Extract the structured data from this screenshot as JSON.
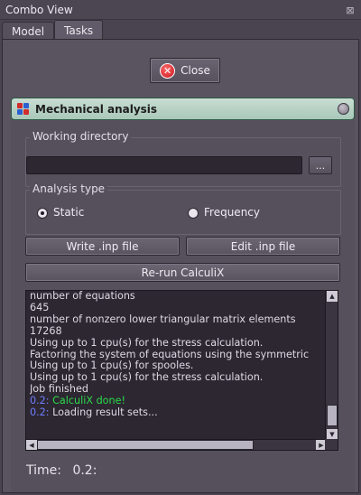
{
  "window": {
    "title": "Combo View",
    "ctrl_icon": "float-close-icon"
  },
  "tabs": [
    {
      "label": "Model"
    },
    {
      "label": "Tasks",
      "active": true
    }
  ],
  "close_button": {
    "label": "Close",
    "icon": "close-icon"
  },
  "mechanical_analysis": {
    "title": "Mechanical analysis",
    "working_directory": {
      "label": "Working directory",
      "value": "",
      "browse_label": "..."
    },
    "analysis_type": {
      "label": "Analysis type",
      "options": [
        {
          "label": "Static",
          "checked": true
        },
        {
          "label": "Frequency",
          "checked": false
        }
      ]
    },
    "buttons": {
      "write_inp": "Write .inp file",
      "edit_inp": "Edit .inp file",
      "rerun": "Re-run CalculiX"
    },
    "log": [
      {
        "text": "number of equations"
      },
      {
        "text": "645"
      },
      {
        "text": "number of nonzero lower triangular matrix elements"
      },
      {
        "text": "17268"
      },
      {
        "text": "Using up to 1 cpu(s) for the stress calculation."
      },
      {
        "text": "Factoring the system of equations using the symmetric"
      },
      {
        "text": "Using up to 1 cpu(s) for spooles."
      },
      {
        "text": "Using up to 1 cpu(s) for the stress calculation."
      },
      {
        "text": "Job finished"
      },
      {
        "time": "0.2:",
        "text": "CalculiX done!",
        "color": "#2bd94a"
      },
      {
        "time": "0.2:",
        "text": "Loading result sets..."
      }
    ],
    "time": {
      "label": "Time:",
      "value": "0.2:"
    }
  }
}
